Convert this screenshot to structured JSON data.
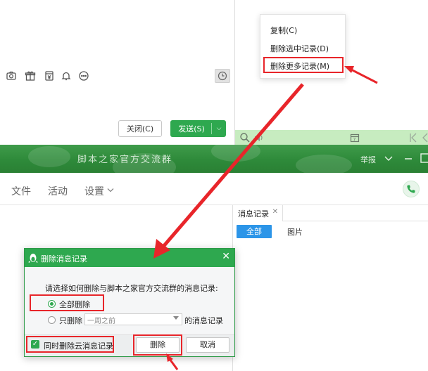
{
  "chat_input": {
    "close_label": "关闭(C)",
    "send_label": "发送(S)",
    "toolbar_icons": [
      "screenshot-icon",
      "gift-icon",
      "red-packet-icon",
      "bell-icon",
      "more-icon",
      "clock-icon"
    ]
  },
  "context_menu": {
    "items": [
      "复制(C)",
      "删除选中记录(D)",
      "删除更多记录(M)"
    ],
    "highlighted_index": 2
  },
  "group": {
    "title": "脚本之家官方交流群",
    "report_label": "举报"
  },
  "nav": {
    "items": [
      "文件",
      "活动",
      "设置"
    ]
  },
  "records_panel": {
    "tab_label": "消息记录",
    "filters": [
      "全部",
      "图片"
    ],
    "active_filter": "全部"
  },
  "dialog": {
    "title": "删除消息记录",
    "prompt": "请选择如何删除与脚本之家官方交流群的消息记录:",
    "option_all": "全部删除",
    "option_partial_prefix": "只删除",
    "option_partial_select": "一周之前",
    "option_partial_suffix": "的消息记录",
    "checkbox_label": "同时删除云消息记录",
    "checkbox_checked": true,
    "delete_label": "删除",
    "cancel_label": "取消"
  },
  "colors": {
    "accent_green": "#2ea84f",
    "annotation_red": "#e8252a",
    "filter_blue": "#2c95e8"
  }
}
